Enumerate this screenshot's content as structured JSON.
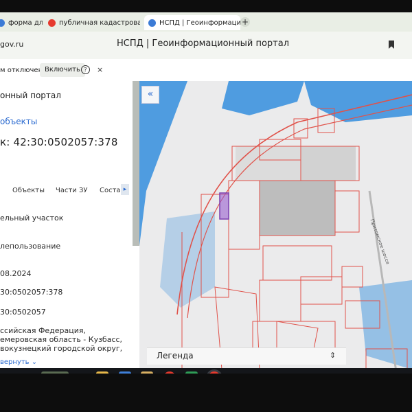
{
  "browser": {
    "tabs": [
      {
        "label": "форма для г",
        "icon_color": "#3b7bd6",
        "active": false
      },
      {
        "label": "публичная кадастровая",
        "icon_color": "#e63a2e",
        "active": false
      },
      {
        "label": "НСПД | Геоинформационный портал",
        "icon_color": "#3b7bd6",
        "active": true
      }
    ],
    "close_glyph": "×",
    "new_tab_glyph": "+",
    "url": "gov.ru",
    "page_title": "НСПД | Геоинформационный портал"
  },
  "infobar": {
    "text": "м отключена",
    "enable_button": "Включить",
    "help_glyph": "?",
    "close_glyph": "×"
  },
  "sidebar": {
    "portal_title": "онный портал",
    "objects_link": "объекты",
    "cadastral_line": "к: 42:30:0502057:378",
    "tabs": [
      {
        "label": "Объекты"
      },
      {
        "label": "Части ЗУ"
      },
      {
        "label": "Состa"
      }
    ],
    "tab_more_glyph": "▸",
    "fields": {
      "type": "ельный участок",
      "usage": "лепользование",
      "date": "08.2024",
      "number": "30:0502057:378",
      "quarter": "30:0502057"
    },
    "address": [
      "ссийская Федерация,",
      "емеровская область - Кузбасс,",
      "вокузнецкий городской округ,"
    ],
    "expand_label": "вернуть"
  },
  "map": {
    "collapse_glyph": "«",
    "legend_label": "Легенда",
    "legend_toggle_glyph": "⇕",
    "road_label": "Притомское шоссе",
    "colors": {
      "water": "#4f9ce0",
      "boundary": "#e0524a",
      "building": "#bdbdbd",
      "selected": "#7d3fb0"
    }
  },
  "taskbar": {
    "icons": [
      "task-view-icon",
      "file-explorer-icon",
      "notes-icon",
      "folder-icon",
      "yandex-icon",
      "excel-icon",
      "yandex-browser-icon"
    ]
  }
}
